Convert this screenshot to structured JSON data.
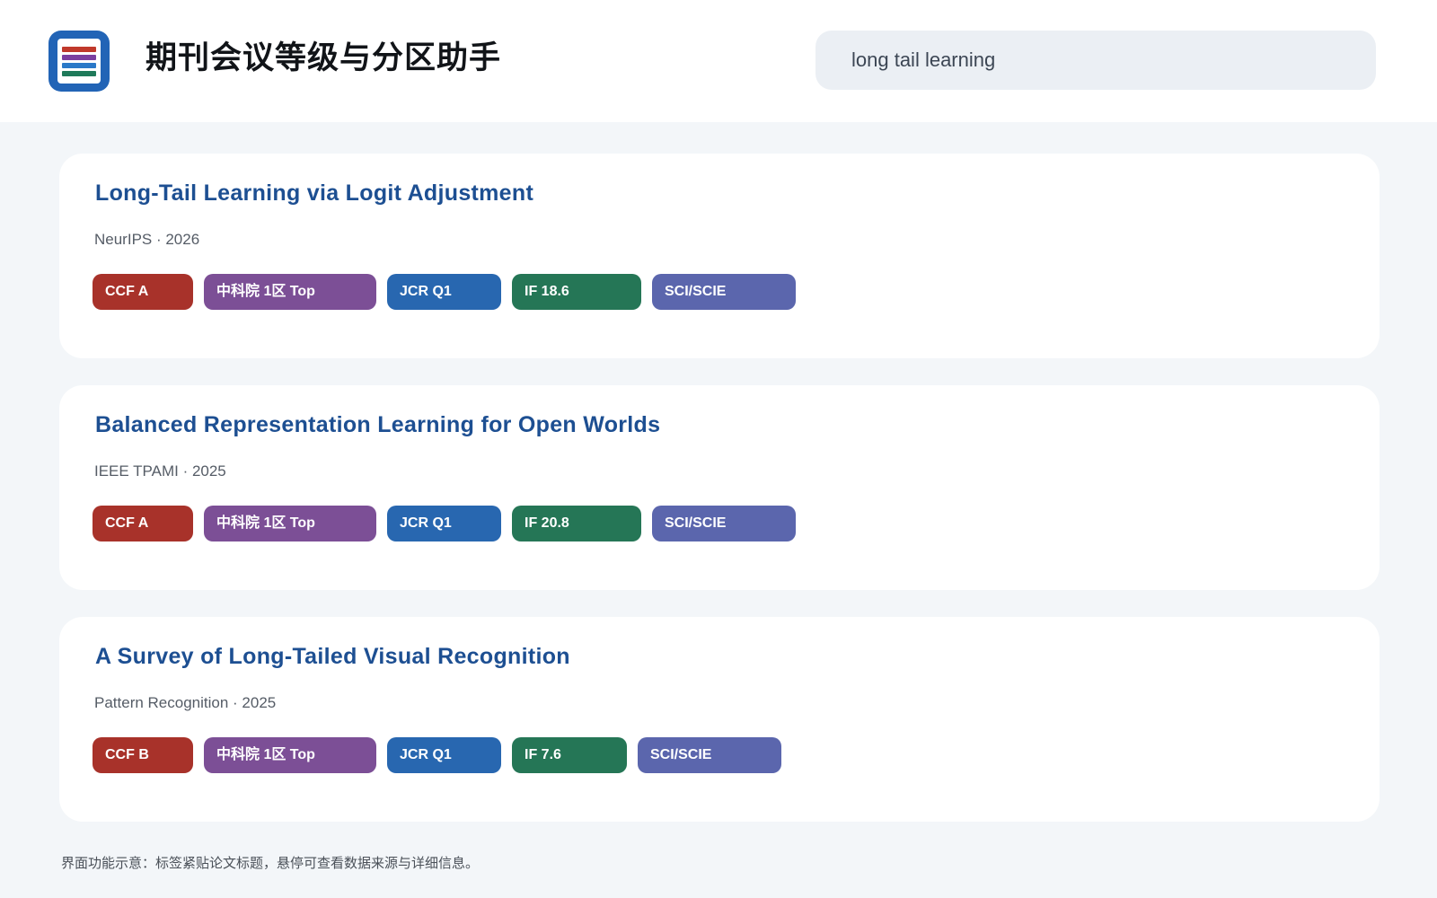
{
  "app": {
    "title": "期刊会议等级与分区助手",
    "icon": "document-list-icon",
    "icon_colors": [
      "#c0392b",
      "#7b3fa0",
      "#2a78c8",
      "#1f7a5a"
    ]
  },
  "search": {
    "value": "long tail learning"
  },
  "tag_colors": {
    "ccf": "#a8322a",
    "cas": "#7c4f96",
    "jcr": "#2867b0",
    "if": "#257656",
    "index": "#5b66ad"
  },
  "results": [
    {
      "title": "Long-Tail Learning via Logit Adjustment",
      "meta": "NeurIPS · 2026",
      "tags": {
        "ccf": "CCF A",
        "cas": "中科院 1区 Top",
        "jcr": "JCR Q1",
        "if": "IF 18.6",
        "index": "SCI/SCIE"
      }
    },
    {
      "title": "Balanced Representation Learning for Open Worlds",
      "meta": "IEEE TPAMI · 2025",
      "tags": {
        "ccf": "CCF A",
        "cas": "中科院 1区 Top",
        "jcr": "JCR Q1",
        "if": "IF 20.8",
        "index": "SCI/SCIE"
      }
    },
    {
      "title": "A Survey of Long-Tailed Visual Recognition",
      "meta": "Pattern Recognition · 2025",
      "tags": {
        "ccf": "CCF B",
        "cas": "中科院 1区 Top",
        "jcr": "JCR Q1",
        "if": "IF 7.6",
        "index": "SCI/SCIE"
      }
    }
  ],
  "footer": {
    "note": "界面功能示意：标签紧贴论文标题，悬停可查看数据来源与详细信息。"
  }
}
